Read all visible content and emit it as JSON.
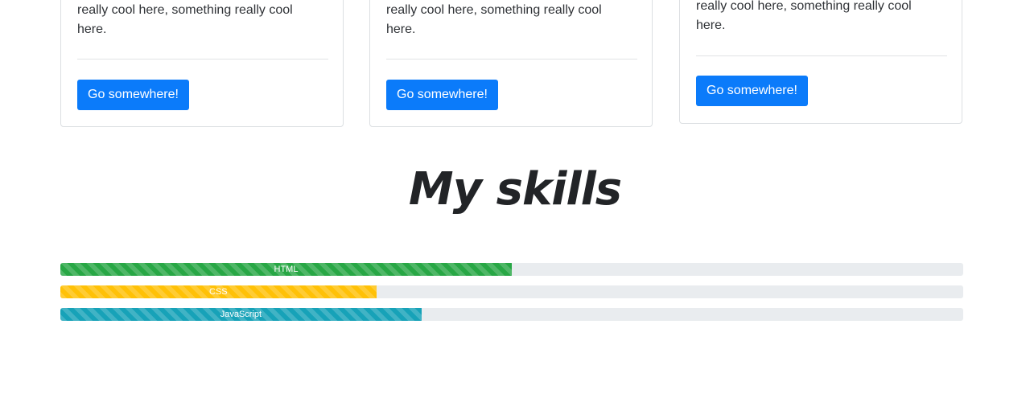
{
  "cards": [
    {
      "text_line_1": "really cool here, something really cool",
      "text_line_2": "here.",
      "button_label": "Go somewhere!"
    },
    {
      "text_line_1": "really cool here, something really cool",
      "text_line_2": "here.",
      "button_label": "Go somewhere!"
    },
    {
      "text_line_1": "really cool here, something really cool",
      "text_line_2": "here.",
      "button_label": "Go somewhere!"
    }
  ],
  "skills": {
    "title": "My skills",
    "bars": [
      {
        "label": "HTML",
        "percent": 50,
        "color": "#28a745"
      },
      {
        "label": "CSS",
        "percent": 35,
        "color": "#ffc107"
      },
      {
        "label": "JavaScript",
        "percent": 40,
        "color": "#17a2b8"
      }
    ]
  }
}
